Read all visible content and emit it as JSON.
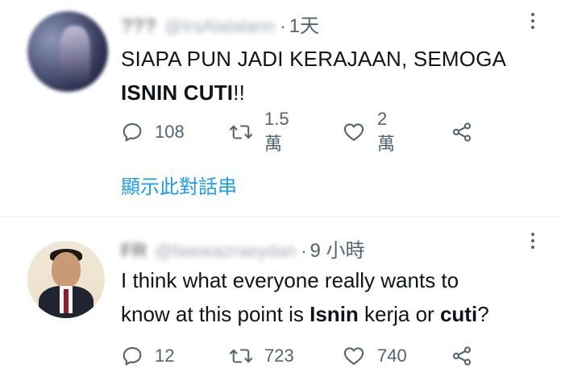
{
  "tweets": [
    {
      "name": "???",
      "handle": "@IrsAlalalann",
      "dot": "·",
      "time": "1天",
      "text_part1": "SIAPA PUN JADI KERAJAAN, SEMOGA",
      "text_bold": "ISNIN CUTI",
      "text_part2": "!!",
      "replies": "108",
      "retweets": "1.5萬",
      "likes": "2萬",
      "thread_link": "顯示此對話串"
    },
    {
      "name": "FR",
      "handle": "@fawwazraeydan",
      "dot": "·",
      "time": "9 小時",
      "line1": "I think what everyone really wants to",
      "line2_a": "know at this point is ",
      "line2_bold1": "Isnin",
      "line2_b": " kerja or ",
      "line2_bold2": "cuti",
      "line2_c": "?",
      "replies": "12",
      "retweets": "723",
      "likes": "740"
    }
  ],
  "icons": {
    "reply": "reply-icon",
    "retweet": "retweet-icon",
    "like": "heart-icon",
    "share": "share-icon",
    "more": "more-icon"
  },
  "colors": {
    "text": "#0f1419",
    "secondary": "#536471",
    "link": "#1d9bf0"
  }
}
